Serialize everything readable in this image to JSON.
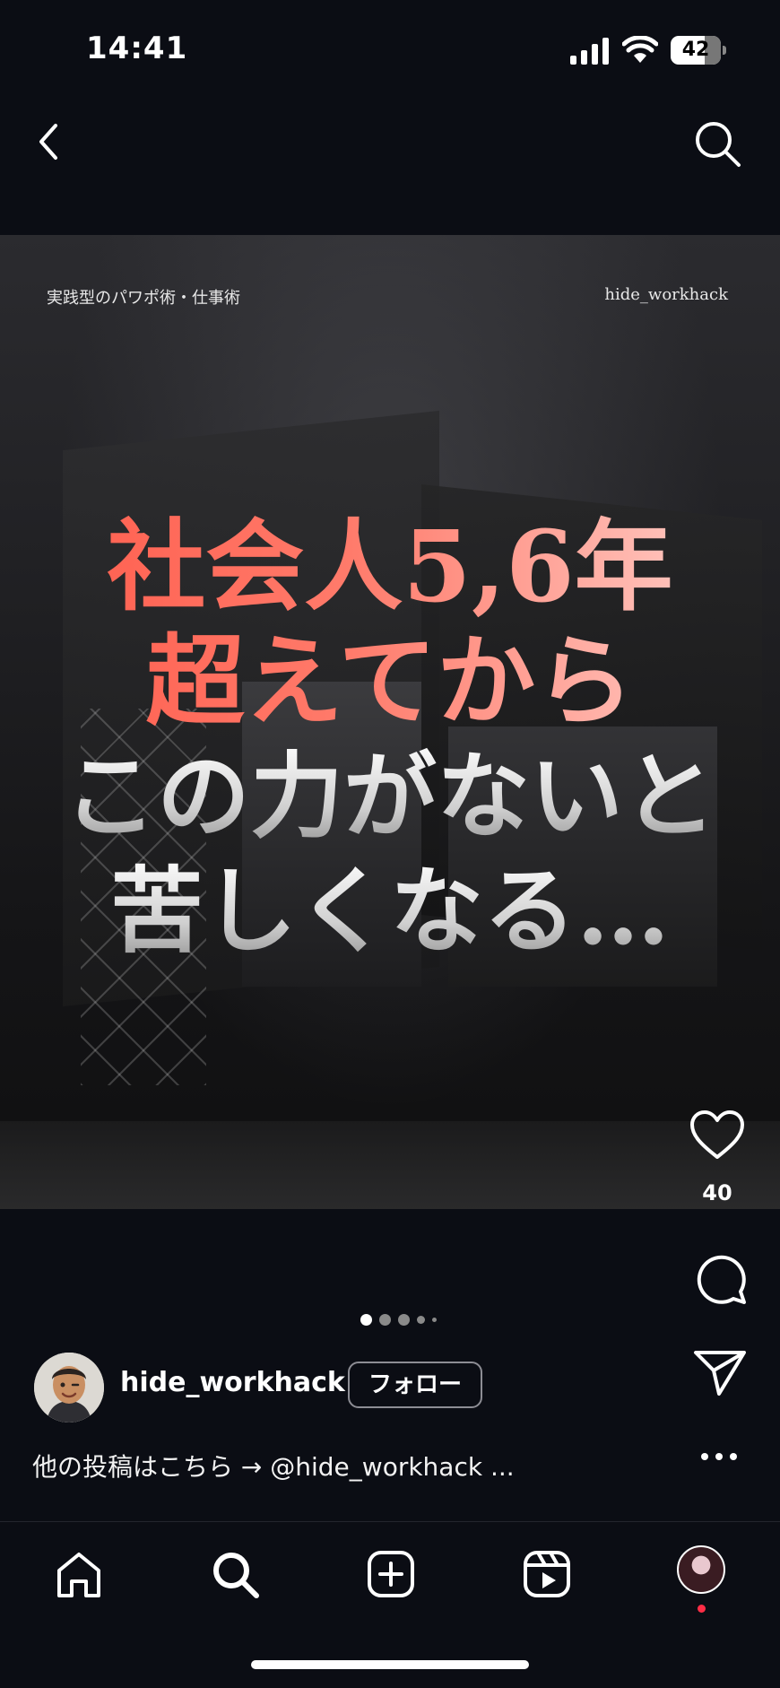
{
  "status_bar": {
    "time": "14:41",
    "battery": "42"
  },
  "post": {
    "image": {
      "label_left": "実践型のパワポ術・仕事術",
      "label_right": "hide_workhack",
      "headline_red": [
        "社会人5,6年",
        "超えてから"
      ],
      "headline_white": [
        "この力がないと",
        "苦しくなる…"
      ]
    },
    "likes": "40",
    "carousel": {
      "total": 5,
      "active": 1
    },
    "author": {
      "username": "hide_workhack",
      "follow_label": "フォロー"
    },
    "caption": "他の投稿はこちら → @hide_workhack ..."
  },
  "icons": {
    "back": "chevron-left-icon",
    "search": "search-icon",
    "like": "heart-icon",
    "comment": "comment-icon",
    "share": "send-icon",
    "more": "more-horizontal-icon",
    "nav": [
      "home-icon",
      "search-icon",
      "create-icon",
      "reels-icon",
      "profile-avatar"
    ]
  },
  "colors": {
    "background": "#0b0d14",
    "headline_red": "#ff5a4a",
    "notification": "#ff2d46"
  }
}
